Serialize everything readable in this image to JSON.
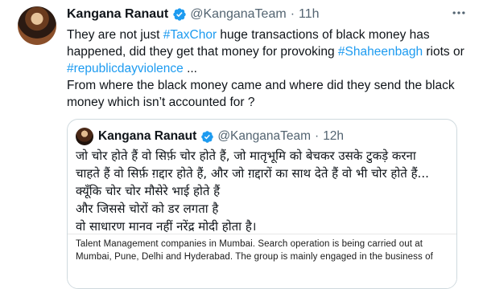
{
  "tweet": {
    "author_name": "Kangana Ranaut",
    "handle": "@KanganaTeam",
    "separator": "·",
    "time": "11h",
    "text_parts": [
      {
        "text": "They are not just ",
        "tag": false
      },
      {
        "text": "#TaxChor",
        "tag": true
      },
      {
        "text": " huge transactions of black money has happened, did they get that money for provoking ",
        "tag": false
      },
      {
        "text": "#Shaheenbagh",
        "tag": true
      },
      {
        "text": " riots or ",
        "tag": false
      },
      {
        "text": "#republicdayviolence",
        "tag": true
      },
      {
        "text": " ...\nFrom where the black money came and  where did they send the black money which isn’t accounted for ?",
        "tag": false
      }
    ]
  },
  "quote": {
    "author_name": "Kangana Ranaut",
    "handle": "@KanganaTeam",
    "separator": "·",
    "time": "12h",
    "lines": [
      "जो चोर होते हैं वो सिर्फ़ चोर होते हैं, जो मातृभूमि को बेचकर उसके टुकड़े करना",
      "चाहते हैं वो सिर्फ़ ग़द्दार होते हैं, और जो ग़द्दारों का साथ देते हैं वो भी चोर होते हैं...",
      "क्यूँकि चोर चोर मौसेरे भाई होते हैं",
      "और जिससे चोरों को डर लगता है",
      "वो साधारण मानव नहीं नरेंद्र मोदी होता है।"
    ],
    "media_lines": [
      "Talent Management companies in Mumbai. Search operation is being carried out at",
      "Mumbai, Pune, Delhi and Hyderabad. The group is mainly engaged in the business of"
    ]
  },
  "colors": {
    "link": "#1d9bf0",
    "verified": "#1d9bf0",
    "secondary_text": "#536471",
    "border": "#cfd9de"
  },
  "icons": {
    "verified": "verified-badge-icon",
    "more": "more-options-icon"
  }
}
